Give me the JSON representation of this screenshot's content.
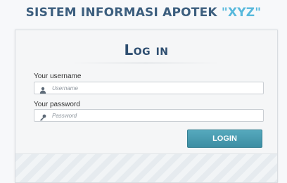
{
  "header": {
    "title_main": "SISTEM INFORMASI APOTEK ",
    "title_accent": "\"XYZ\""
  },
  "login": {
    "heading": "Log in",
    "username_label": "Your username",
    "username_placeholder": "Username",
    "password_label": "Your password",
    "password_placeholder": "Password",
    "button_label": "LOGIN"
  },
  "colors": {
    "title": "#3c5e7e",
    "accent": "#58b9dc",
    "button": "#4a9db1"
  },
  "icons": {
    "username": "user-icon",
    "password": "key-icon"
  }
}
